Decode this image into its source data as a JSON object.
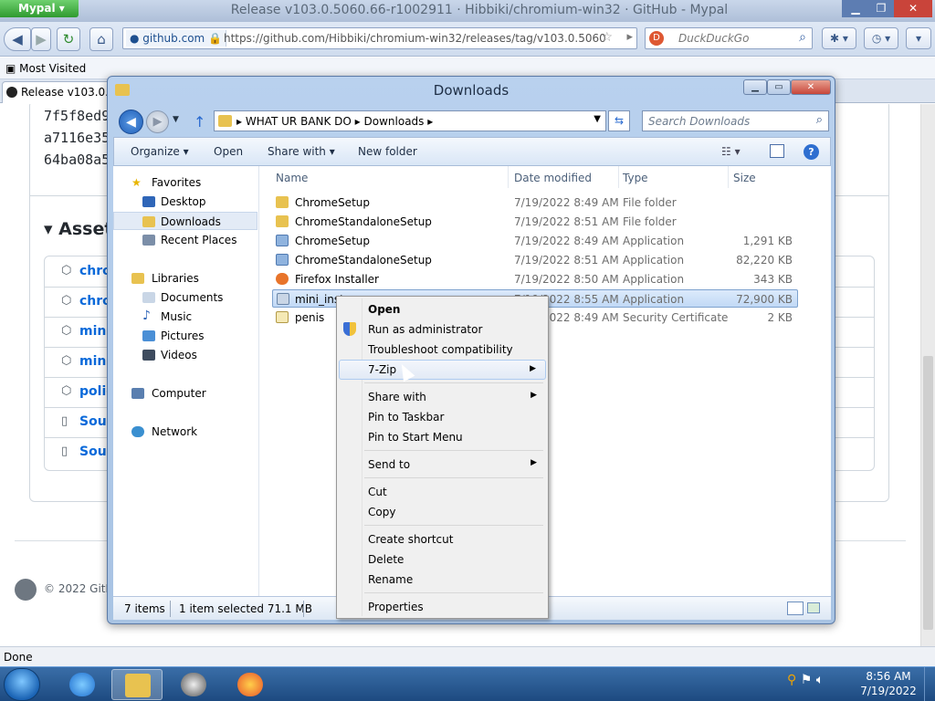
{
  "browser": {
    "app_menu": "Mypal",
    "title": "Release v103.0.5060.66-r1002911 · Hibbiki/chromium-win32 · GitHub - Mypal",
    "identity": "github.com",
    "url": "https://github.com/Hibbiki/chromium-win32/releases/tag/v103.0.5060.66-r1(",
    "search_placeholder": "DuckDuckGo",
    "bookmark": "Most Visited",
    "tab_title": "Release v103.0.5060.66",
    "status": "Done"
  },
  "github": {
    "hashes": [
      "7f5f8ed9a",
      "a7116e35",
      "64ba08a5"
    ],
    "assets_heading": "Asset",
    "assets": [
      "chro",
      "chro",
      "mini",
      "mini",
      "polic",
      "Sour",
      "Sour"
    ],
    "footer": "© 2022 GitHu"
  },
  "explorer": {
    "title": "Downloads",
    "breadcrumb": "▸  WHAT UR BANK DO  ▸  Downloads  ▸",
    "search_placeholder": "Search Downloads",
    "commands": {
      "organize": "Organize ▾",
      "open": "Open",
      "share": "Share with ▾",
      "new_folder": "New folder"
    },
    "nav": {
      "favorites": "Favorites",
      "desktop": "Desktop",
      "downloads": "Downloads",
      "recent": "Recent Places",
      "libraries": "Libraries",
      "documents": "Documents",
      "music": "Music",
      "pictures": "Pictures",
      "videos": "Videos",
      "computer": "Computer",
      "network": "Network"
    },
    "columns": {
      "name": "Name",
      "date": "Date modified",
      "type": "Type",
      "size": "Size"
    },
    "files": [
      {
        "name": "ChromeSetup",
        "date": "7/19/2022 8:49 AM",
        "type": "File folder",
        "size": ""
      },
      {
        "name": "ChromeStandaloneSetup",
        "date": "7/19/2022 8:51 AM",
        "type": "File folder",
        "size": ""
      },
      {
        "name": "ChromeSetup",
        "date": "7/19/2022 8:49 AM",
        "type": "Application",
        "size": "1,291 KB"
      },
      {
        "name": "ChromeStandaloneSetup",
        "date": "7/19/2022 8:51 AM",
        "type": "Application",
        "size": "82,220 KB"
      },
      {
        "name": "Firefox Installer",
        "date": "7/19/2022 8:50 AM",
        "type": "Application",
        "size": "343 KB"
      },
      {
        "name": "mini_inst",
        "date": "7/19/2022 8:55 AM",
        "type": "Application",
        "size": "72,900 KB"
      },
      {
        "name": "penis",
        "date": "7/19/2022 8:49 AM",
        "type": "Security Certificate",
        "size": "2 KB"
      }
    ],
    "status_count": "7 items",
    "status_selected": "1 item selected  71.1 MB"
  },
  "context_menu": {
    "open": "Open",
    "run_as_admin": "Run as administrator",
    "troubleshoot": "Troubleshoot compatibility",
    "seven_zip": "7-Zip",
    "share_with": "Share with",
    "pin_taskbar": "Pin to Taskbar",
    "pin_start": "Pin to Start Menu",
    "send_to": "Send to",
    "cut": "Cut",
    "copy": "Copy",
    "create_shortcut": "Create shortcut",
    "delete": "Delete",
    "rename": "Rename",
    "properties": "Properties"
  },
  "taskbar": {
    "time": "8:56 AM",
    "date": "7/19/2022"
  }
}
